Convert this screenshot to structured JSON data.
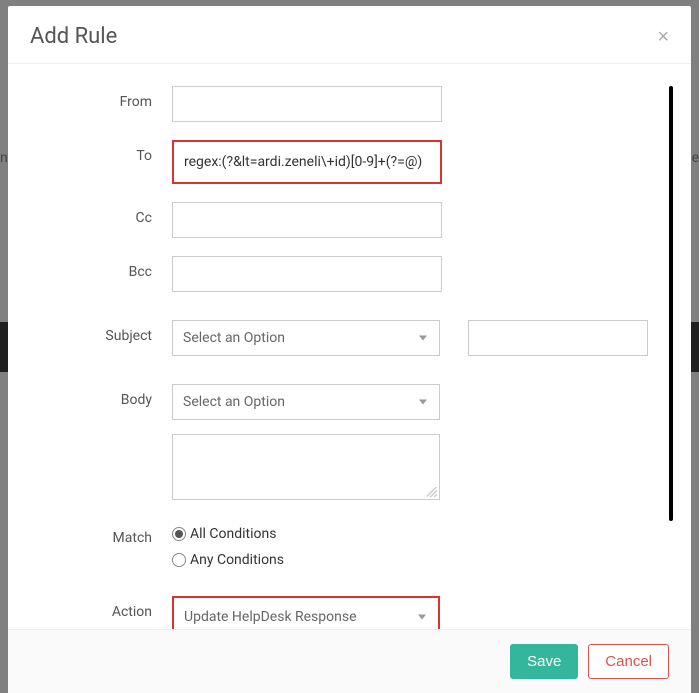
{
  "peek": {
    "left": "n",
    "right": "e"
  },
  "modal": {
    "title": "Add Rule",
    "close": "×"
  },
  "fields": {
    "from": {
      "label": "From",
      "value": ""
    },
    "to": {
      "label": "To",
      "value": "regex:(?&lt=ardi.zeneli\\+id)[0-9]+(?=@)"
    },
    "cc": {
      "label": "Cc",
      "value": ""
    },
    "bcc": {
      "label": "Bcc",
      "value": ""
    },
    "subject": {
      "label": "Subject",
      "placeholder": "Select an Option"
    },
    "body": {
      "label": "Body",
      "placeholder": "Select an Option",
      "textarea": ""
    },
    "match": {
      "label": "Match",
      "options": {
        "all": "All Conditions",
        "any": "Any Conditions"
      },
      "selected": "all"
    },
    "action": {
      "label": "Action",
      "value": "Update HelpDesk Response"
    }
  },
  "footer": {
    "save": "Save",
    "cancel": "Cancel"
  }
}
